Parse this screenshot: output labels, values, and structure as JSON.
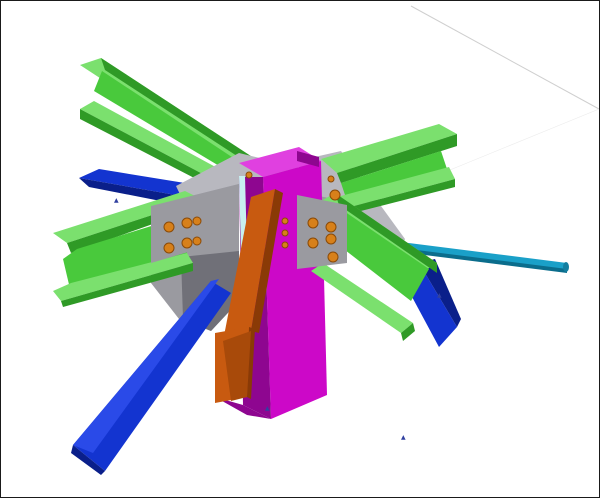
{
  "viewport": {
    "background": "#ffffff",
    "border_color": "#1a1a1a"
  },
  "colors": {
    "green_beam": "#49c93c",
    "green_dark": "#2f9a26",
    "green_light": "#7be06e",
    "gray_plate": "#9a9aa0",
    "gray_dark": "#707078",
    "gray_light": "#b8b8bf",
    "magenta_column": "#cc08c8",
    "magenta_dark": "#8e0690",
    "magenta_light": "#e040e0",
    "orange_brace": "#c85a10",
    "orange_dark": "#8a3a06",
    "blue_brace": "#1334d0",
    "blue_dark": "#0a1f8a",
    "cyan_rod": "#1aa0c8",
    "bolt": "#d7801a",
    "bolt_dark": "#8a4a08",
    "grid_line": "#c8c8c8",
    "marker": "#3040a0"
  },
  "members": [
    {
      "name": "column-magenta"
    },
    {
      "name": "beam-green-nw"
    },
    {
      "name": "beam-green-w"
    },
    {
      "name": "beam-green-ne"
    },
    {
      "name": "beam-green-se"
    },
    {
      "name": "brace-orange"
    },
    {
      "name": "brace-blue-sw"
    },
    {
      "name": "brace-blue-nw"
    },
    {
      "name": "brace-blue-se"
    },
    {
      "name": "rod-cyan"
    }
  ],
  "icons": {
    "axis_marker": "axis-marker-icon"
  }
}
